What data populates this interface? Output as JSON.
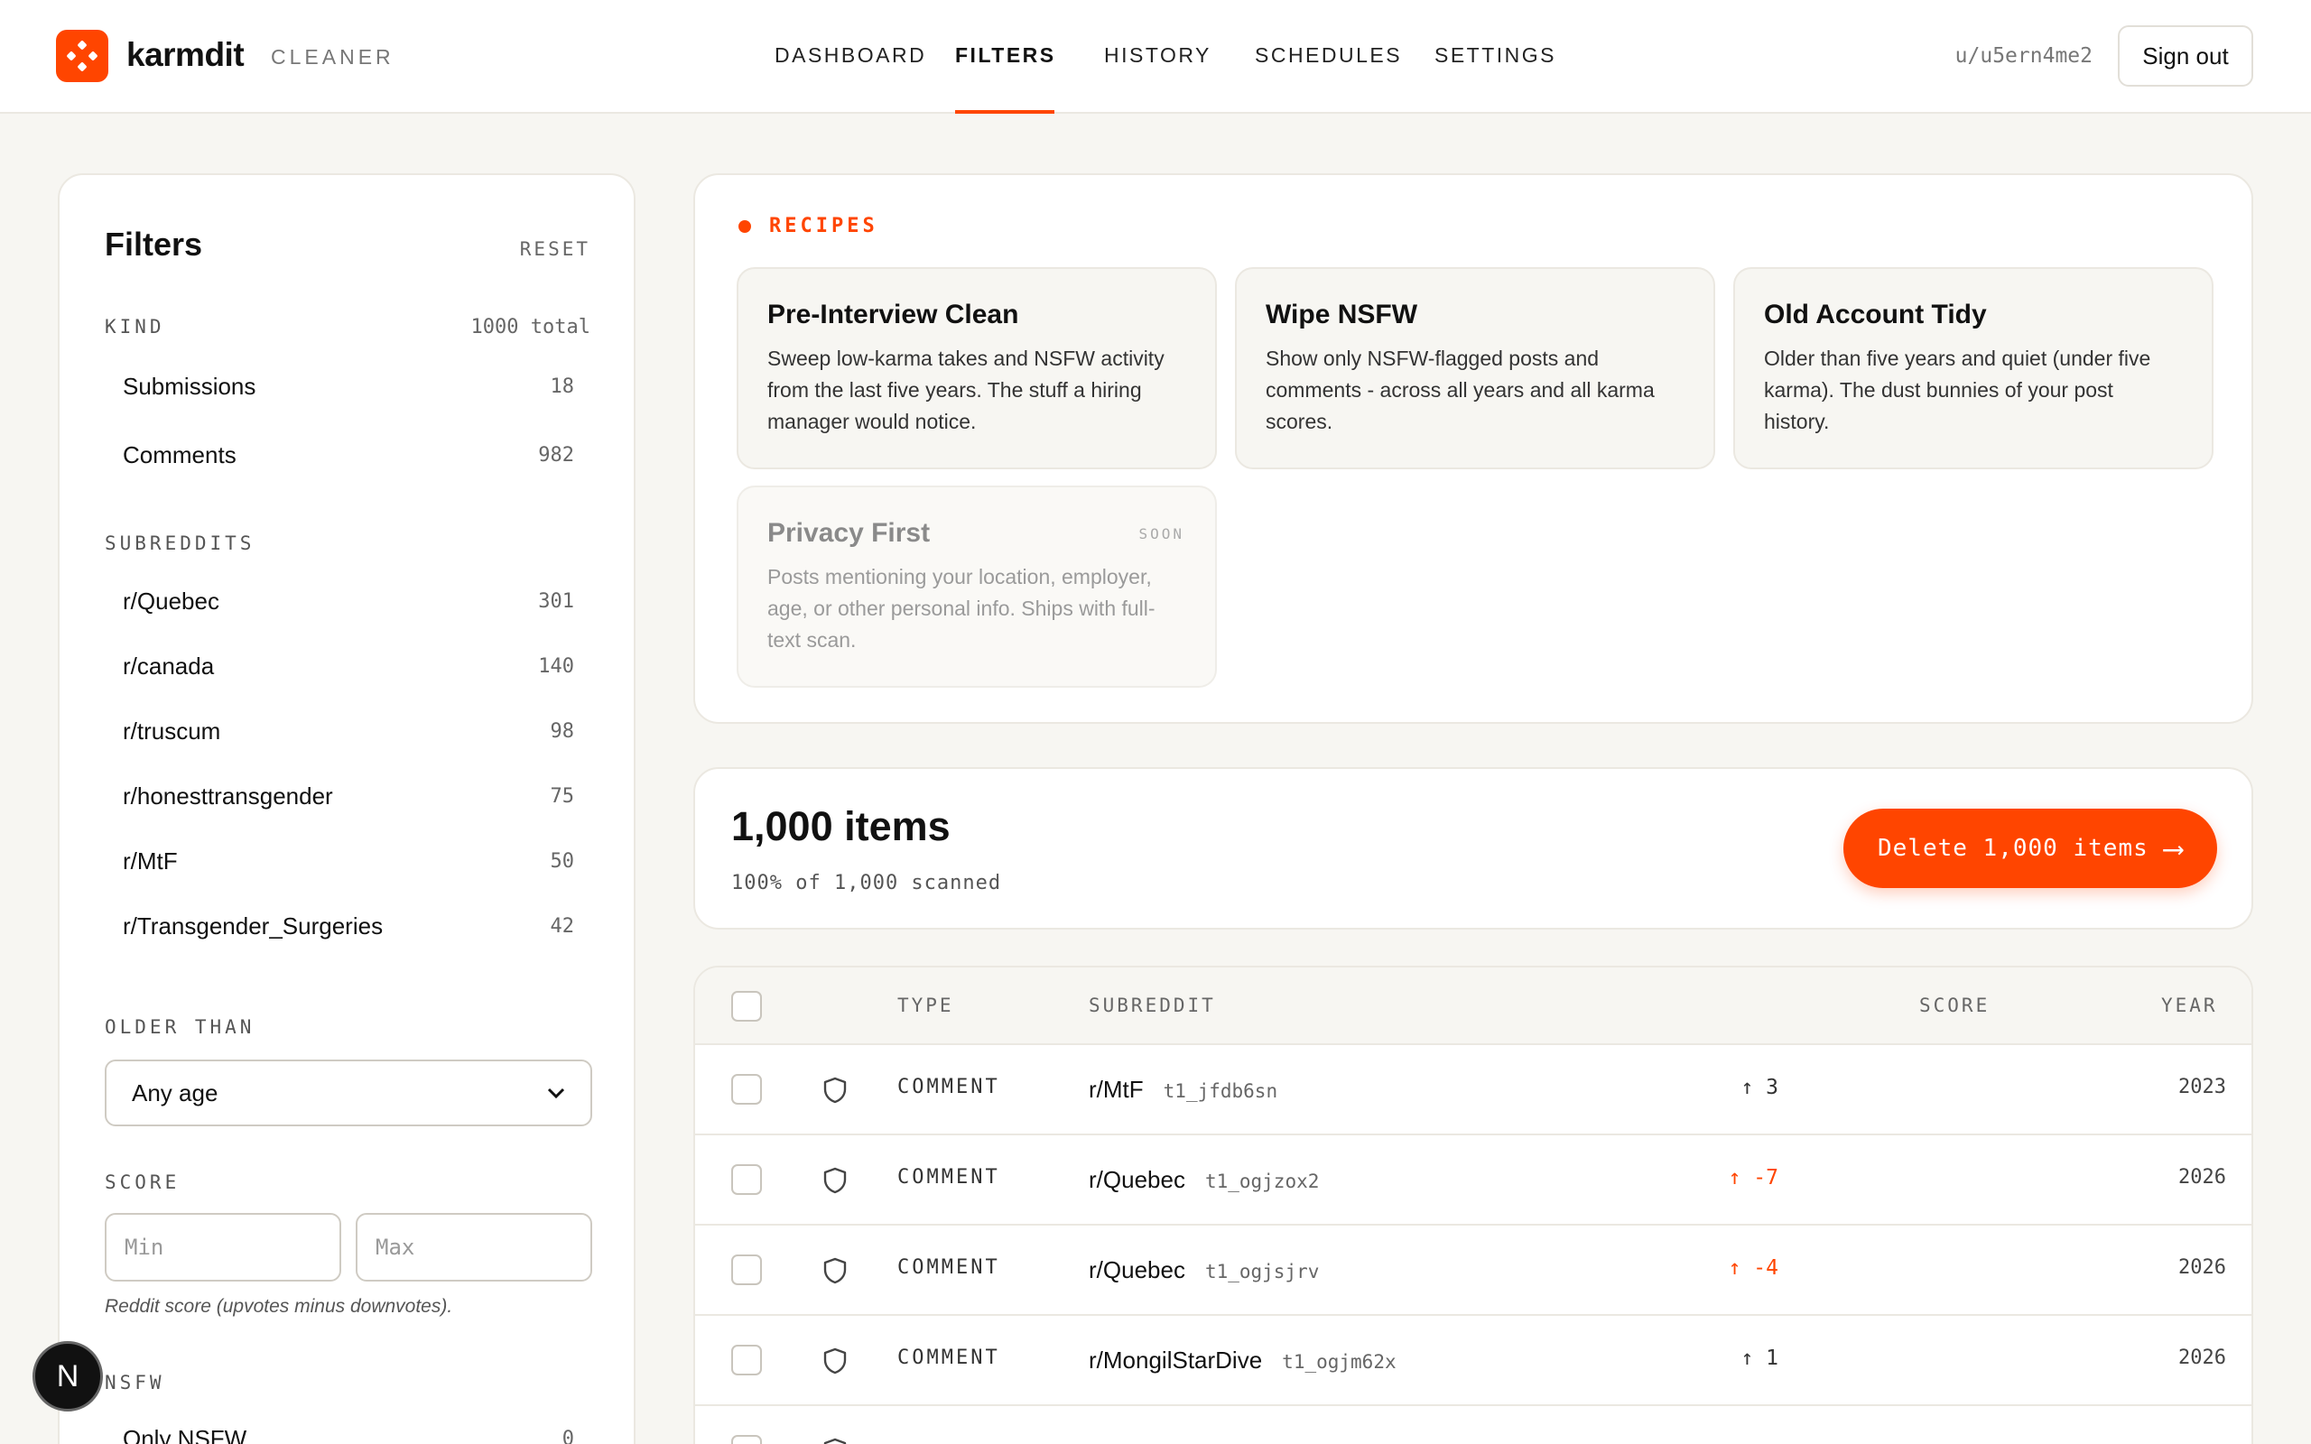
{
  "brand": {
    "name": "karmdit",
    "sub": "CLEANER",
    "accent": "#ff4500"
  },
  "nav": {
    "items": [
      {
        "label": "DASHBOARD"
      },
      {
        "label": "FILTERS"
      },
      {
        "label": "HISTORY"
      },
      {
        "label": "SCHEDULES"
      },
      {
        "label": "SETTINGS"
      }
    ],
    "active": "FILTERS"
  },
  "user": {
    "username": "u/u5ern4me2",
    "signout_label": "Sign out"
  },
  "filters": {
    "title": "Filters",
    "reset_label": "RESET",
    "kind": {
      "label": "KIND",
      "total": "1000 total",
      "items": [
        {
          "label": "Submissions",
          "count": "18"
        },
        {
          "label": "Comments",
          "count": "982"
        }
      ]
    },
    "subreddits": {
      "label": "SUBREDDITS",
      "items": [
        {
          "label": "r/Quebec",
          "count": "301"
        },
        {
          "label": "r/canada",
          "count": "140"
        },
        {
          "label": "r/truscum",
          "count": "98"
        },
        {
          "label": "r/honesttransgender",
          "count": "75"
        },
        {
          "label": "r/MtF",
          "count": "50"
        },
        {
          "label": "r/Transgender_Surgeries",
          "count": "42"
        }
      ]
    },
    "older_than": {
      "label": "OLDER THAN",
      "value": "Any age"
    },
    "score": {
      "label": "SCORE",
      "min_placeholder": "Min",
      "max_placeholder": "Max",
      "hint": "Reddit score (upvotes minus downvotes)."
    },
    "nsfw": {
      "label": "NSFW",
      "items": [
        {
          "label": "Only NSFW",
          "count": "0"
        }
      ]
    }
  },
  "recipes": {
    "label": "RECIPES",
    "items": [
      {
        "title": "Pre-Interview Clean",
        "desc": "Sweep low-karma takes and NSFW activity from the last five years. The stuff a hiring manager would notice."
      },
      {
        "title": "Wipe NSFW",
        "desc": "Show only NSFW-flagged posts and comments - across all years and all karma scores."
      },
      {
        "title": "Old Account Tidy",
        "desc": "Older than five years and quiet (under five karma). The dust bunnies of your post history."
      },
      {
        "title": "Privacy First",
        "desc": "Posts mentioning your location, employer, age, or other personal info. Ships with full-text scan.",
        "badge": "SOON"
      }
    ]
  },
  "summary": {
    "count_label": "1,000 items",
    "scanned": "100% of 1,000 scanned",
    "delete_label": "Delete 1,000 items",
    "delete_arrow": "⟶"
  },
  "table": {
    "headers": {
      "type": "TYPE",
      "subreddit": "SUBREDDIT",
      "score": "SCORE",
      "year": "YEAR"
    },
    "rows": [
      {
        "type": "COMMENT",
        "subreddit": "r/MtF",
        "id": "t1_jfdb6sn",
        "score": "3",
        "score_dir": "pos",
        "year": "2023"
      },
      {
        "type": "COMMENT",
        "subreddit": "r/Quebec",
        "id": "t1_ogjzox2",
        "score": "-7",
        "score_dir": "neg",
        "year": "2026"
      },
      {
        "type": "COMMENT",
        "subreddit": "r/Quebec",
        "id": "t1_ogjsjrv",
        "score": "-4",
        "score_dir": "neg",
        "year": "2026"
      },
      {
        "type": "COMMENT",
        "subreddit": "r/MongilStarDive",
        "id": "t1_ogjm62x",
        "score": "1",
        "score_dir": "pos",
        "year": "2026"
      }
    ]
  },
  "fab": {
    "label": "N"
  }
}
